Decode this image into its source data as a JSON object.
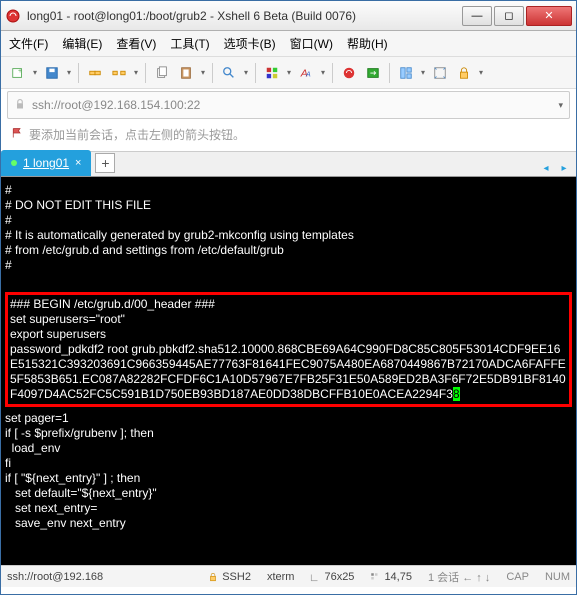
{
  "window": {
    "title": "long01 - root@long01:/boot/grub2 - Xshell 6 Beta (Build 0076)"
  },
  "menu": {
    "file": "文件(F)",
    "edit": "编辑(E)",
    "view": "查看(V)",
    "tools": "工具(T)",
    "tab": "选项卡(B)",
    "window": "窗口(W)",
    "help": "帮助(H)"
  },
  "address": {
    "url": "ssh://root@192.168.154.100:22"
  },
  "hint": {
    "text": "要添加当前会话，点击左侧的箭头按钮。"
  },
  "tab": {
    "label": "1 long01"
  },
  "terminal": {
    "l1": "#",
    "l2": "# DO NOT EDIT THIS FILE",
    "l3": "#",
    "l4": "# It is automatically generated by grub2-mkconfig using templates",
    "l5": "# from /etc/grub.d and settings from /etc/default/grub",
    "l6": "#",
    "h1": "### BEGIN /etc/grub.d/00_header ###",
    "h2": "set superusers=\"root\"",
    "h3": "export superusers",
    "h4": "password_pdkdf2 root grub.pbkdf2.sha512.10000.868CBE69A64C990FD8C85C805F53014CDF9EE16E515321C393203691C966359445AE77763F81641FEC9075A480EA6870449867B72170ADCA6FAFFE5F5853B651.EC087A82282FCFDF6C1A10D57967E7FB25F31E50A589ED2BA3F6F72E5DB91BF8140F4097D4AC52FC5C591B1D750EB93BD187AE0DD38DBCFFB10E0ACEA2294F3",
    "h4_cursor": "8",
    "a1": "set pager=1",
    "a2": "",
    "a3": "if [ -s $prefix/grubenv ]; then",
    "a4": "  load_env",
    "a5": "fi",
    "a6": "if [ \"${next_entry}\" ] ; then",
    "a7": "   set default=\"${next_entry}\"",
    "a8": "   set next_entry=",
    "a9": "   save_env next_entry"
  },
  "status": {
    "addr": "ssh://root@192.168",
    "proto": "SSH2",
    "term": "xterm",
    "size": "76x25",
    "pos": "14,75",
    "cap": "CAP",
    "num": "NUM"
  }
}
